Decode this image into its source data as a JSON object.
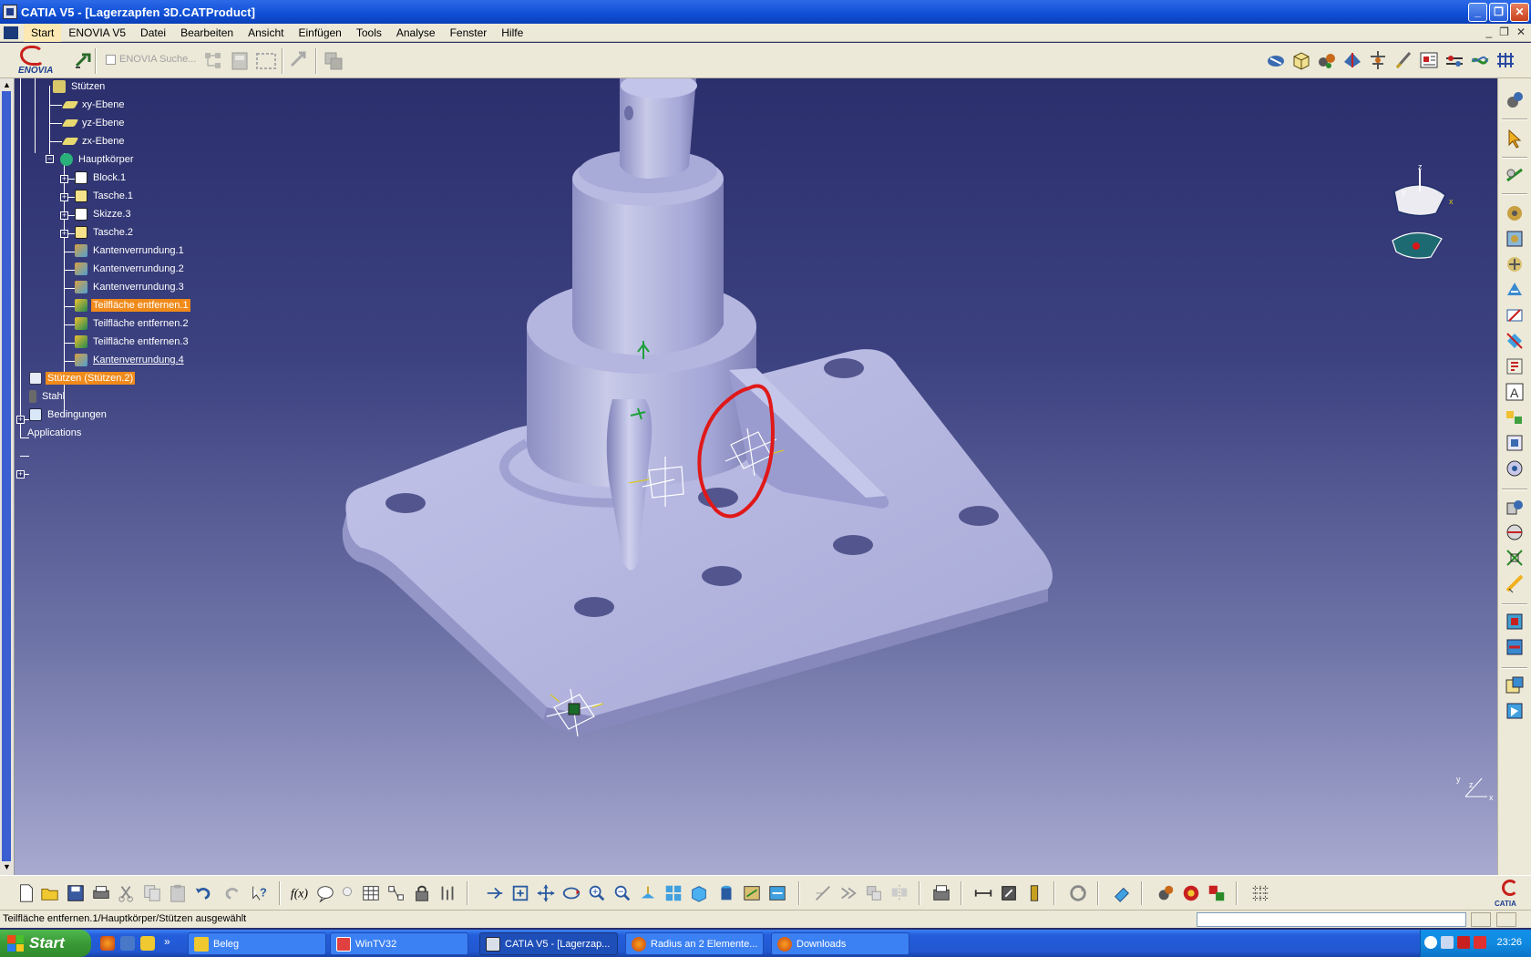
{
  "window": {
    "title": "CATIA V5 - [Lagerzapfen 3D.CATProduct]",
    "controls": [
      "minimize",
      "restore",
      "close"
    ]
  },
  "menu": {
    "items": [
      "Start",
      "ENOVIA V5",
      "Datei",
      "Bearbeiten",
      "Ansicht",
      "Einfügen",
      "Tools",
      "Analyse",
      "Fenster",
      "Hilfe"
    ],
    "active": "Start"
  },
  "toolbar": {
    "enovia_logo": "ENOVIA",
    "enovia_search": "ENOVIA Suche..."
  },
  "tree": {
    "nodes": [
      {
        "label": "Stützen",
        "icon": "part-icon",
        "selected": false,
        "underline": false
      },
      {
        "label": "xy-Ebene",
        "icon": "plane-icon",
        "selected": false,
        "underline": false
      },
      {
        "label": "yz-Ebene",
        "icon": "plane-icon",
        "selected": false,
        "underline": false
      },
      {
        "label": "zx-Ebene",
        "icon": "plane-icon",
        "selected": false,
        "underline": false
      },
      {
        "label": "Hauptkörper",
        "icon": "body-icon",
        "selected": false,
        "underline": false
      },
      {
        "label": "Block.1",
        "icon": "pad-icon",
        "selected": false,
        "underline": false
      },
      {
        "label": "Tasche.1",
        "icon": "pocket-icon",
        "selected": false,
        "underline": false
      },
      {
        "label": "Skizze.3",
        "icon": "sketch-icon",
        "selected": false,
        "underline": false
      },
      {
        "label": "Tasche.2",
        "icon": "pocket-icon",
        "selected": false,
        "underline": false
      },
      {
        "label": "Kantenverrundung.1",
        "icon": "fillet-icon",
        "selected": false,
        "underline": false
      },
      {
        "label": "Kantenverrundung.2",
        "icon": "fillet-icon",
        "selected": false,
        "underline": false
      },
      {
        "label": "Kantenverrundung.3",
        "icon": "fillet-icon",
        "selected": false,
        "underline": false
      },
      {
        "label": "Teilfläche entfernen.1",
        "icon": "remove-face-icon",
        "selected": true,
        "underline": false
      },
      {
        "label": "Teilfläche entfernen.2",
        "icon": "remove-face-icon",
        "selected": false,
        "underline": false
      },
      {
        "label": "Teilfläche entfernen.3",
        "icon": "remove-face-icon",
        "selected": false,
        "underline": false
      },
      {
        "label": "Kantenverrundung.4",
        "icon": "fillet-icon",
        "selected": false,
        "underline": true
      },
      {
        "label": "Stützen (Stützen.2)",
        "icon": "product-icon",
        "selected": true,
        "underline": false
      },
      {
        "label": "Stahl",
        "icon": "material-icon",
        "selected": false,
        "underline": false
      },
      {
        "label": "Bedingungen",
        "icon": "constraints-icon",
        "selected": false,
        "underline": false
      },
      {
        "label": "Applications",
        "icon": "",
        "selected": false,
        "underline": false
      }
    ]
  },
  "viewport": {
    "compass_labels": {
      "x": "x",
      "y": "y",
      "z": "z"
    },
    "axis_corner": {
      "x": "x",
      "y": "y",
      "z": "z"
    },
    "annotation": "red freehand circle marking fillet area",
    "colors": {
      "background_top": "#2b2f6c",
      "background_bottom": "#a8aad0",
      "part": "#b9bbe2",
      "highlight": "#f08a1a",
      "annotation": "#e01818"
    }
  },
  "status": {
    "text": "Teilfläche entfernen.1/Hauptkörper/Stützen ausgewählt"
  },
  "taskbar": {
    "start": "Start",
    "tasks": [
      {
        "label": "Beleg",
        "icon": "folder-icon",
        "active": false
      },
      {
        "label": "WinTV32",
        "icon": "wintv-icon",
        "active": false
      },
      {
        "label": "CATIA V5 - [Lagerzap...",
        "icon": "catia-icon",
        "active": true
      },
      {
        "label": "Radius an 2 Elemente...",
        "icon": "firefox-icon",
        "active": false
      },
      {
        "label": "Downloads",
        "icon": "firefox-icon",
        "active": false
      }
    ],
    "clock": "23:26"
  }
}
